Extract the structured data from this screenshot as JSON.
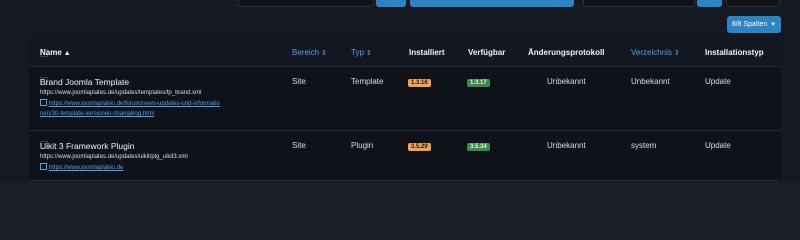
{
  "toolbar": {
    "columns_button": "8/8 Spalten"
  },
  "table": {
    "headers": {
      "name": "Name",
      "bereich": "Bereich",
      "typ": "Typ",
      "installiert": "Installiert",
      "verfuegbar": "Verfügbar",
      "aenderungsprotokoll": "Änderungsprotokoll",
      "verzeichnis": "Verzeichnis",
      "installationstyp": "Installationstyp"
    },
    "rows": [
      {
        "name": "Brand Joomla Template",
        "url": "https://www.joomlaplates.de/updates/templates/tp_brand.xml",
        "info_line1": "https://www.joomlaplates.de/forum/news-updates-und-informatio",
        "info_line2": "nen/30-template-versionen-changelog.html",
        "bereich": "Site",
        "typ": "Template",
        "installiert": "1.3.16",
        "verfuegbar": "1.3.17",
        "aenderungsprotokoll": "Unbekannt",
        "verzeichnis": "Unbekannt",
        "installationstyp": "Update"
      },
      {
        "name": "Uikit 3 Framework Plugin",
        "url": "https://www.joomlaplates.de/updates/uikit/plg_uikit3.xml",
        "info_line1": "https://www.joomlaplates.de",
        "bereich": "Site",
        "typ": "Plugin",
        "installiert": "3.5.29",
        "verfuegbar": "3.5.34",
        "aenderungsprotokoll": "Unbekannt",
        "verzeichnis": "system",
        "installationstyp": "Update"
      }
    ]
  },
  "colors": {
    "accent": "#2d84c4",
    "link": "#4aa3e8",
    "badge_installed": "#f0a34a",
    "badge_available": "#3a8a4a"
  }
}
